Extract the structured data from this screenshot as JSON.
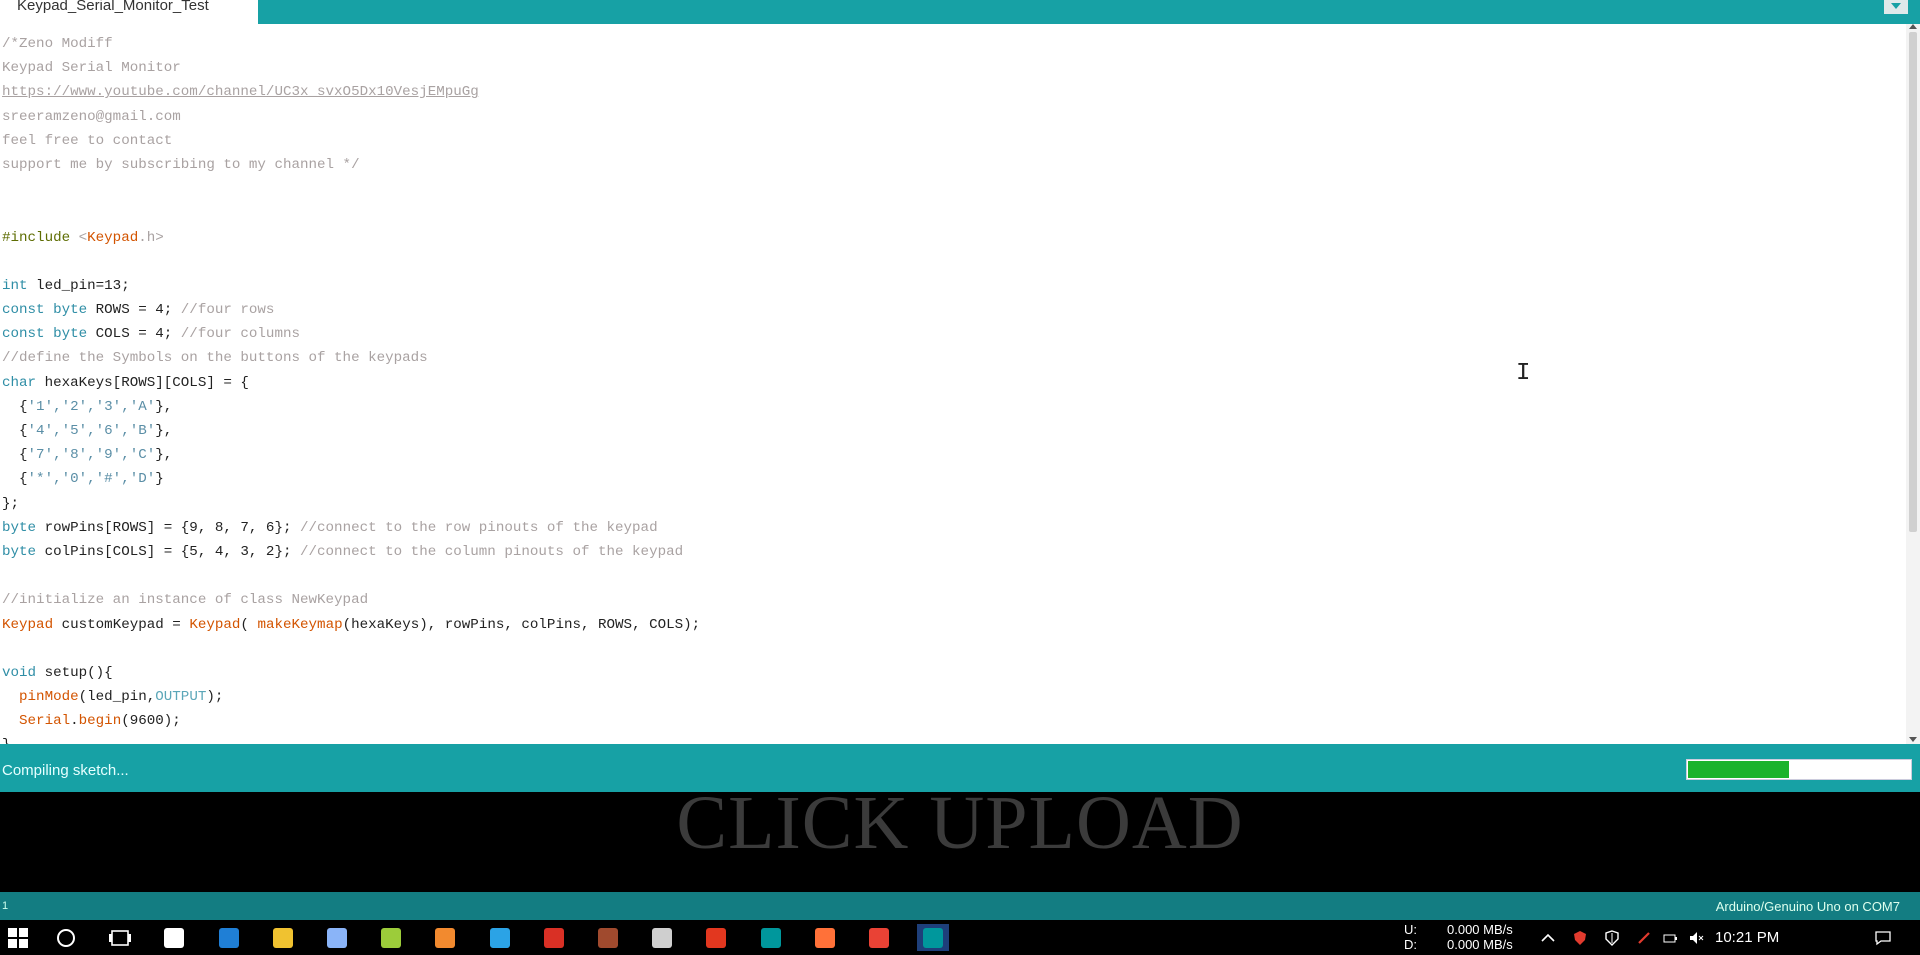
{
  "tab": {
    "title": "Keypad_Serial_Monitor_Test"
  },
  "code": [
    [
      {
        "c": "t-comment",
        "t": "/*Zeno Modiff"
      }
    ],
    [
      {
        "c": "t-comment",
        "t": "Keypad Serial Monitor"
      }
    ],
    [
      {
        "c": "t-link",
        "t": "https://www.youtube.com/channel/UC3x_svxO5Dx10VesjEMpuGg"
      }
    ],
    [
      {
        "c": "t-comment",
        "t": "sreeramzeno@gmail.com"
      }
    ],
    [
      {
        "c": "t-comment",
        "t": "feel free to contact"
      }
    ],
    [
      {
        "c": "t-comment",
        "t": "support me by subscribing to my channel */"
      }
    ],
    [],
    [],
    [
      {
        "c": "t-inc",
        "t": "#include "
      },
      {
        "c": "t-comment",
        "t": "<"
      },
      {
        "c": "t-fn",
        "t": "Keypad"
      },
      {
        "c": "t-comment",
        "t": ".h>"
      }
    ],
    [],
    [
      {
        "c": "t-kw",
        "t": "int"
      },
      {
        "c": "",
        "t": " led_pin=13;"
      }
    ],
    [
      {
        "c": "t-kw",
        "t": "const byte"
      },
      {
        "c": "",
        "t": " ROWS = 4; "
      },
      {
        "c": "t-comment",
        "t": "//four rows"
      }
    ],
    [
      {
        "c": "t-kw",
        "t": "const byte"
      },
      {
        "c": "",
        "t": " COLS = 4; "
      },
      {
        "c": "t-comment",
        "t": "//four columns"
      }
    ],
    [
      {
        "c": "t-comment",
        "t": "//define the Symbols on the buttons of the keypads"
      }
    ],
    [
      {
        "c": "t-kw",
        "t": "char"
      },
      {
        "c": "",
        "t": " hexaKeys[ROWS][COLS] = {"
      }
    ],
    [
      {
        "c": "",
        "t": "  {"
      },
      {
        "c": "t-str",
        "t": "'1','2','3','A'"
      },
      {
        "c": "",
        "t": "},"
      }
    ],
    [
      {
        "c": "",
        "t": "  {"
      },
      {
        "c": "t-str",
        "t": "'4','5','6','B'"
      },
      {
        "c": "",
        "t": "},"
      }
    ],
    [
      {
        "c": "",
        "t": "  {"
      },
      {
        "c": "t-str",
        "t": "'7','8','9','C'"
      },
      {
        "c": "",
        "t": "},"
      }
    ],
    [
      {
        "c": "",
        "t": "  {"
      },
      {
        "c": "t-str",
        "t": "'*','0','#','D'"
      },
      {
        "c": "",
        "t": "}"
      }
    ],
    [
      {
        "c": "",
        "t": "};"
      }
    ],
    [
      {
        "c": "t-kw",
        "t": "byte"
      },
      {
        "c": "",
        "t": " rowPins[ROWS] = {9, 8, 7, 6}; "
      },
      {
        "c": "t-comment",
        "t": "//connect to the row pinouts of the keypad"
      }
    ],
    [
      {
        "c": "t-kw",
        "t": "byte"
      },
      {
        "c": "",
        "t": " colPins[COLS] = {5, 4, 3, 2}; "
      },
      {
        "c": "t-comment",
        "t": "//connect to the column pinouts of the keypad"
      }
    ],
    [],
    [
      {
        "c": "t-comment",
        "t": "//initialize an instance of class NewKeypad"
      }
    ],
    [
      {
        "c": "t-fn",
        "t": "Keypad"
      },
      {
        "c": "",
        "t": " customKeypad = "
      },
      {
        "c": "t-fn",
        "t": "Keypad"
      },
      {
        "c": "",
        "t": "( "
      },
      {
        "c": "t-fn",
        "t": "makeKeymap"
      },
      {
        "c": "",
        "t": "(hexaKeys), rowPins, colPins, ROWS, COLS);"
      }
    ],
    [],
    [
      {
        "c": "t-kw",
        "t": "void"
      },
      {
        "c": "",
        "t": " setup(){"
      }
    ],
    [
      {
        "c": "",
        "t": "  "
      },
      {
        "c": "t-fn",
        "t": "pinMode"
      },
      {
        "c": "",
        "t": "(led_pin,"
      },
      {
        "c": "t-lit",
        "t": "OUTPUT"
      },
      {
        "c": "",
        "t": ");"
      }
    ],
    [
      {
        "c": "",
        "t": "  "
      },
      {
        "c": "t-fn",
        "t": "Serial"
      },
      {
        "c": "",
        "t": "."
      },
      {
        "c": "t-fn",
        "t": "begin"
      },
      {
        "c": "",
        "t": "(9600);"
      }
    ],
    [
      {
        "c": "",
        "t": "}"
      }
    ]
  ],
  "status": {
    "text": "Compiling sketch...",
    "progress": 0.45
  },
  "overlay": {
    "text": "CLICK UPLOAD"
  },
  "boardbar": {
    "line": "1",
    "board": "Arduino/Genuino Uno on COM7"
  },
  "taskbar": {
    "net_labels": [
      "U:",
      "D:"
    ],
    "net_values": [
      "0.000 MB/s",
      "0.000 MB/s"
    ],
    "clock": "10:21 PM",
    "apps": [
      "windows-start-icon",
      "cortana-icon",
      "task-view-icon",
      "store-icon",
      "edge-icon",
      "file-explorer-icon",
      "notepad-icon",
      "android-icon",
      "app-orange-icon",
      "app-blue-icon",
      "acrobat-icon",
      "winrar-icon",
      "snipping-icon",
      "foxit-icon",
      "arduino-icon",
      "firefox-icon",
      "chrome-icon",
      "arduino-active-icon"
    ]
  },
  "colors": {
    "accent": "#17a1a5",
    "board_bar": "#137d82",
    "progress": "#1bb32c"
  }
}
